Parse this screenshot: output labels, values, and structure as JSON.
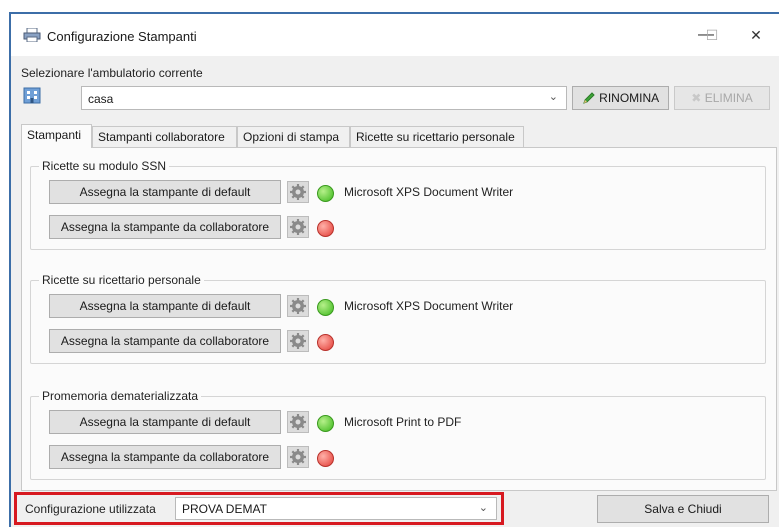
{
  "window": {
    "title": "Configurazione Stampanti",
    "minimize_glyph": "—",
    "maximize_glyph": "☐",
    "close_glyph": "✕"
  },
  "ambulatorio": {
    "label": "Selezionare l'ambulatorio corrente",
    "value": "casa",
    "icon": "building-icon",
    "rename_label": "RINOMINA",
    "delete_label": "ELIMINA"
  },
  "tabs": [
    {
      "label": "Stampanti",
      "active": true
    },
    {
      "label": "Stampanti collaboratore",
      "active": false
    },
    {
      "label": "Opzioni di stampa",
      "active": false
    },
    {
      "label": "Ricette su ricettario personale",
      "active": false
    }
  ],
  "groups": [
    {
      "title": "Ricette su modulo SSN",
      "rows": [
        {
          "button": "Assegna la stampante di default",
          "status": "green",
          "printer": "Microsoft XPS Document Writer"
        },
        {
          "button": "Assegna la stampante da collaboratore",
          "status": "red",
          "printer": ""
        }
      ]
    },
    {
      "title": "Ricette su ricettario personale",
      "rows": [
        {
          "button": "Assegna la stampante di default",
          "status": "green",
          "printer": "Microsoft XPS Document Writer"
        },
        {
          "button": "Assegna la stampante da collaboratore",
          "status": "red",
          "printer": ""
        }
      ]
    },
    {
      "title": "Promemoria dematerializzata",
      "rows": [
        {
          "button": "Assegna la stampante di default",
          "status": "green",
          "printer": "Microsoft Print to PDF"
        },
        {
          "button": "Assegna la stampante da collaboratore",
          "status": "red",
          "printer": ""
        }
      ]
    }
  ],
  "footer": {
    "config_label": "Configurazione utilizzata",
    "config_value": "PROVA DEMAT",
    "save_label": "Salva e Chiudi"
  },
  "colors": {
    "status_green": "#3cb81c",
    "status_red": "#e23b34",
    "highlight_border": "#d71920",
    "window_border": "#3c6ea8"
  }
}
